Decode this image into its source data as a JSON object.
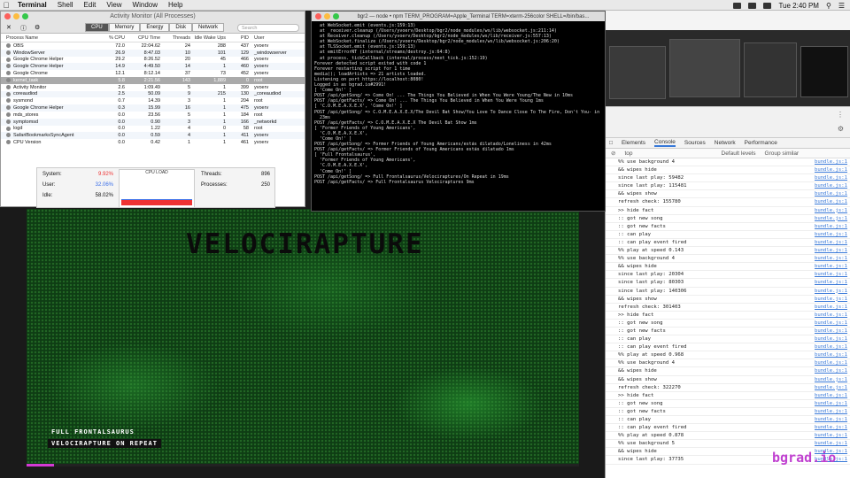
{
  "menubar": {
    "apple": "",
    "items": [
      "Terminal",
      "Shell",
      "Edit",
      "View",
      "Window",
      "Help"
    ],
    "clock": "Tue 2:40 PM"
  },
  "activity_monitor": {
    "title": "Activity Monitor (All Processes)",
    "tabs": [
      "CPU",
      "Memory",
      "Energy",
      "Disk",
      "Network"
    ],
    "active_tab": "CPU",
    "search_placeholder": "Search",
    "columns": [
      "Process Name",
      "% CPU",
      "CPU Time",
      "Threads",
      "Idle Wake Ups",
      "PID",
      "User"
    ],
    "rows": [
      [
        "OBS",
        "72.0",
        "22:04.62",
        "24",
        "288",
        "437",
        "yvoerv"
      ],
      [
        "WindowServer",
        "26.9",
        "8:47.03",
        "10",
        "101",
        "129",
        "_windowserver"
      ],
      [
        "Google Chrome Helper",
        "29.2",
        "8:26.52",
        "20",
        "45",
        "466",
        "yvoerv"
      ],
      [
        "Google Chrome Helper",
        "14.9",
        "4:49.50",
        "14",
        "1",
        "460",
        "yvoerv"
      ],
      [
        "Google Chrome",
        "12.1",
        "8:12.14",
        "37",
        "73",
        "452",
        "yvoerv"
      ],
      [
        "kernel_task",
        "5.8",
        "2:21.56",
        "143",
        "1,889",
        "0",
        "root"
      ],
      [
        "Activity Monitor",
        "2.6",
        "1:09.49",
        "5",
        "1",
        "399",
        "yvoerv"
      ],
      [
        "coreaudiod",
        "2.5",
        "50.09",
        "9",
        "215",
        "130",
        "_coreaudiod"
      ],
      [
        "sysmond",
        "0.7",
        "14.39",
        "3",
        "1",
        "204",
        "root"
      ],
      [
        "Google Chrome Helper",
        "0.3",
        "15.99",
        "16",
        "1",
        "475",
        "yvoerv"
      ],
      [
        "mds_stores",
        "0.0",
        "23.56",
        "5",
        "1",
        "184",
        "root"
      ],
      [
        "symptomsd",
        "0.0",
        "0.90",
        "3",
        "1",
        "166",
        "_networkd"
      ],
      [
        "logd",
        "0.0",
        "1.22",
        "4",
        "0",
        "58",
        "root"
      ],
      [
        "SafariBookmarksSyncAgent",
        "0.0",
        "0.59",
        "4",
        "1",
        "411",
        "yvoerv"
      ],
      [
        "CPU Version",
        "0.0",
        "0.42",
        "1",
        "1",
        "461",
        "yvoerv"
      ]
    ],
    "footer": {
      "system_label": "System:",
      "system_value": "9.92%",
      "user_label": "User:",
      "user_value": "32.06%",
      "idle_label": "Idle:",
      "idle_value": "58.02%",
      "cpu_load_label": "CPU LOAD",
      "threads_label": "Threads:",
      "threads_value": "896",
      "processes_label": "Processes:",
      "processes_value": "250"
    }
  },
  "terminal": {
    "title": "bgr2 — node • npm TERM_PROGRAM=Apple_Terminal TERM=xterm-256color SHELL=/bin/bas...",
    "lines": [
      "  at WebSocket.emit (events.js:159:13)",
      "  at _receiver.cleanup (/Users/yvoerv/Desktop/bgr2/node_modules/ws/lib/websocket.js:211:14)",
      "  at Receiver.cleanup (/Users/yvoerv/Desktop/bgr2/node_modules/ws/lib/receiver.js:557:13)",
      "  at WebSocket.finalize (/Users/yvoerv/Desktop/bgr2/node_modules/ws/lib/websocket.js:206:20)",
      "  at TLSSocket.emit (events.js:159:13)",
      "  at emitErrorNT (internal/streams/destroy.js:64:8)",
      "  at process._tickCallback (internal/process/next_tick.js:152:19)",
      "Forever detected script exited with code 1",
      "Forever restarting script for 1 time",
      "media(); loadArtists => 21 artists loaded.",
      "Listening on port https://localhost:8080!",
      "Logged in as bgrad.io#2991!",
      "[ 'Come On!' ]",
      "POST /api/getSong/ => Come On! ... The Things You Believed in When You Were Young/The New in 10ms",
      "POST /api/getFacts/ => Come On! ... The Things You Believed in When You Were Young 1ms",
      "[ 'C.O.M.E.A.X.E.X', 'Come On!' ]",
      "POST /api/getSong/ => C.O.M.E.A.X.E.X/The Devil Bat Show/You Love To Dance Close To The Fire, Don't You- in",
      "  23ms",
      "POST /api/getFacts/ => C.O.M.E.A.X.E.X The Devil Bat Show 1ms",
      "[ 'Former Friends of Young Americans',",
      "  'C.O.M.E.A.X.E.X',",
      "  'Come On!' ]",
      "POST /api/getSong/ => Former Friends of Young Americans/estás dilatado/Loneliness in 42ms",
      "POST /api/getFacts/ => Former Friends of Young Americans estás dilatado 1ms",
      "[ 'Full Frontalsaurus',",
      "  'Former Friends of Young Americans',",
      "  'C.O.M.E.A.X.E.X',",
      "  'Come On!' ]",
      "POST /api/getSong/ => Full Frontalsaurus/Velociraptures/On Repeat in 19ms",
      "POST /api/getFacts/ => Full Frontalsaurus Velociraptures 9ms"
    ]
  },
  "devtools": {
    "tabs": [
      "Elements",
      "Console",
      "Sources",
      "Network",
      "Performance"
    ],
    "active_tab": "Console",
    "context": "top",
    "levels": "Default levels",
    "group_similar": "Group similar",
    "lines": [
      [
        "%% use background 4",
        "bundle.js:1"
      ],
      [
        "&& wipes hide",
        "bundle.js:1"
      ],
      [
        "since last play: 59482",
        "bundle.js:1"
      ],
      [
        "since last play: 115481",
        "bundle.js:1"
      ],
      [
        "&& wipes show",
        "bundle.js:1"
      ],
      [
        "refresh check: 155780",
        "bundle.js:1"
      ],
      [
        ">> hide fact",
        "bundle.js:1"
      ],
      [
        ":: got new song",
        "bundle.js:1"
      ],
      [
        ":: got new facts",
        "bundle.js:1"
      ],
      [
        ":: can play",
        "bundle.js:1"
      ],
      [
        ":: can play event fired",
        "bundle.js:1"
      ],
      [
        "%% play at speed 0.143",
        "bundle.js:1"
      ],
      [
        "%% use background 4",
        "bundle.js:1"
      ],
      [
        "&& wipes hide",
        "bundle.js:1"
      ],
      [
        "since last play: 20304",
        "bundle.js:1"
      ],
      [
        "since last play: 80303",
        "bundle.js:1"
      ],
      [
        "since last play: 140306",
        "bundle.js:1"
      ],
      [
        "&& wipes show",
        "bundle.js:1"
      ],
      [
        "refresh check: 301403",
        "bundle.js:1"
      ],
      [
        ">> hide fact",
        "bundle.js:1"
      ],
      [
        ":: got new song",
        "bundle.js:1"
      ],
      [
        ":: got new facts",
        "bundle.js:1"
      ],
      [
        ":: can play",
        "bundle.js:1"
      ],
      [
        ":: can play event fired",
        "bundle.js:1"
      ],
      [
        "%% play at speed 0.968",
        "bundle.js:1"
      ],
      [
        "%% use background 4",
        "bundle.js:1"
      ],
      [
        "&& wipes hide",
        "bundle.js:1"
      ],
      [
        "&& wipes show",
        "bundle.js:1"
      ],
      [
        "refresh check: 322270",
        "bundle.js:1"
      ],
      [
        ">> hide fact",
        "bundle.js:1"
      ],
      [
        ":: got new song",
        "bundle.js:1"
      ],
      [
        ":: got new facts",
        "bundle.js:1"
      ],
      [
        ":: can play",
        "bundle.js:1"
      ],
      [
        ":: can play event fired",
        "bundle.js:1"
      ],
      [
        "%% play at speed 0.878",
        "bundle.js:1"
      ],
      [
        "%% use background 5",
        "bundle.js:1"
      ],
      [
        "&& wipes hide",
        "bundle.js:1"
      ],
      [
        "since last play: 37735",
        "bundle.js:1"
      ]
    ]
  },
  "video": {
    "title": "VELOCIRAPTURE",
    "caption_artist": "FULL FRONTALSAURUS",
    "caption_song": "VELOCIRAPTURE  ON REPEAT",
    "logo": "bgrad.io",
    "progress": 0.05
  },
  "colors": {
    "accent_blue": "#3879d9",
    "video_green": "#1e7a27",
    "brand_magenta": "#c040d0",
    "system_red": "#e33333"
  }
}
